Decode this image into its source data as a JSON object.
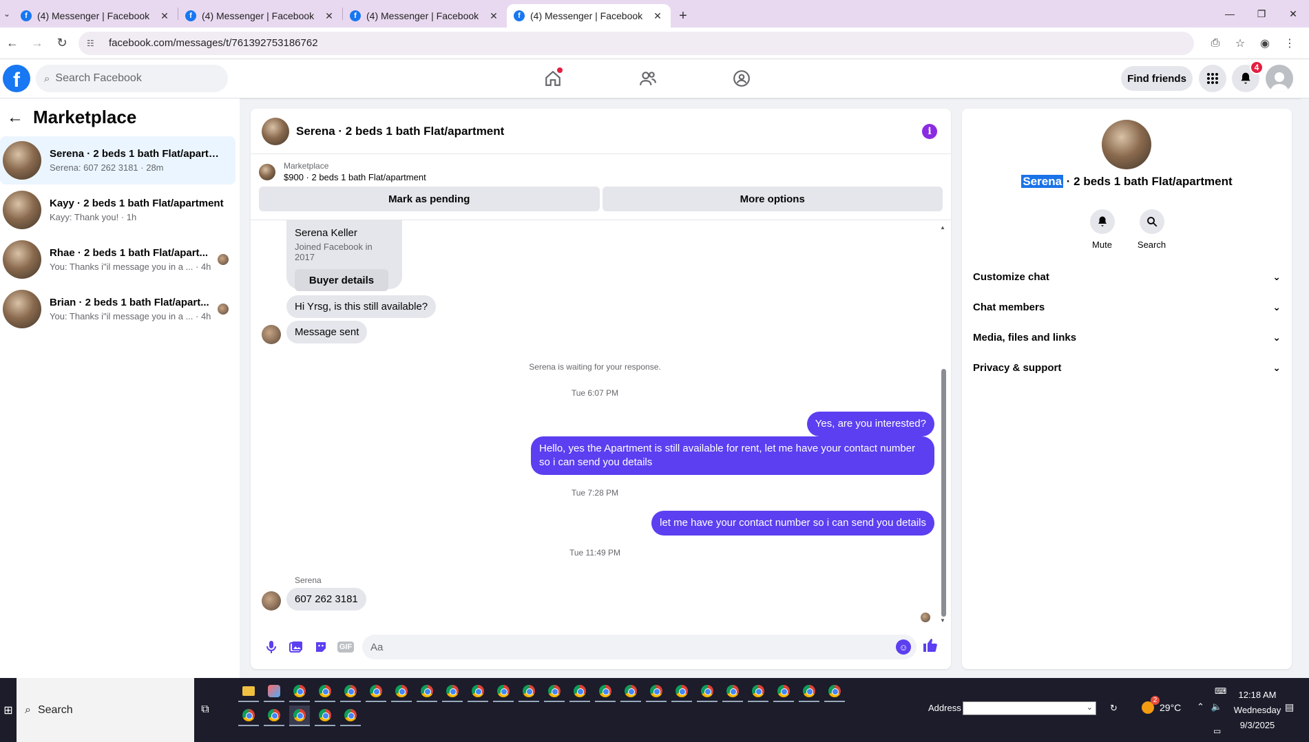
{
  "browser": {
    "tabs": [
      {
        "title": "(4) Messenger | Facebook",
        "active": false
      },
      {
        "title": "(4) Messenger | Facebook",
        "active": false
      },
      {
        "title": "(4) Messenger | Facebook",
        "active": false
      },
      {
        "title": "(4) Messenger | Facebook",
        "active": true
      }
    ],
    "url": "facebook.com/messages/t/761392753186762"
  },
  "fbnav": {
    "search_placeholder": "Search Facebook",
    "find_friends": "Find friends",
    "notification_count": "4"
  },
  "sidebar": {
    "title": "Marketplace",
    "conversations": [
      {
        "name": "Serena · 2 beds 1 bath Flat/apartm...",
        "preview": "Serena: 607 262 3181 · 28m",
        "active": true
      },
      {
        "name": "Kayy · 2 beds 1 bath Flat/apartment",
        "preview": "Kayy: Thank you! · 1h",
        "active": false
      },
      {
        "name": "Rhae · 2 beds 1 bath Flat/apart...",
        "preview": "You: Thanks i\"il message you in a ... · 4h",
        "active": false
      },
      {
        "name": "Brian · 2 beds 1 bath Flat/apart...",
        "preview": "You: Thanks i\"il message you in a ... · 4h",
        "active": false
      }
    ]
  },
  "chat": {
    "title": "Serena · 2 beds 1 bath Flat/apartment",
    "listing": {
      "source": "Marketplace",
      "price_title": "$900 · 2 beds 1 bath Flat/apartment",
      "mark_pending": "Mark as pending",
      "more_options": "More options"
    },
    "profile_card": {
      "name": "Serena Keller",
      "joined": "Joined Facebook in 2017",
      "button": "Buyer details"
    },
    "messages": {
      "m1": "Hi Yrsg, is this still available?",
      "m2": "Message sent",
      "waiting": "Serena is waiting for your response.",
      "ts1": "Tue 6:07 PM",
      "m3": "Yes, are you interested?",
      "m4": "Hello, yes the Apartment is still available for rent, let me have your contact number so i can send you details",
      "ts2": "Tue 7:28 PM",
      "m5": "let me have your contact number so i can send you details",
      "ts3": "Tue 11:49 PM",
      "sender_label": "Serena",
      "m6": "607 262 3181"
    },
    "composer_placeholder": "Aa",
    "accent": "#5b3ff0"
  },
  "rpanel": {
    "title_highlight": "Serena",
    "title_rest": " · 2 beds 1 bath Flat/apartment",
    "mute": "Mute",
    "search": "Search",
    "sections": [
      "Customize chat",
      "Chat members",
      "Media, files and links",
      "Privacy & support"
    ]
  },
  "taskbar": {
    "search": "Search",
    "address_label": "Address",
    "temperature": "29°C",
    "time": "12:18 AM",
    "day": "Wednesday",
    "date": "9/3/2025"
  }
}
